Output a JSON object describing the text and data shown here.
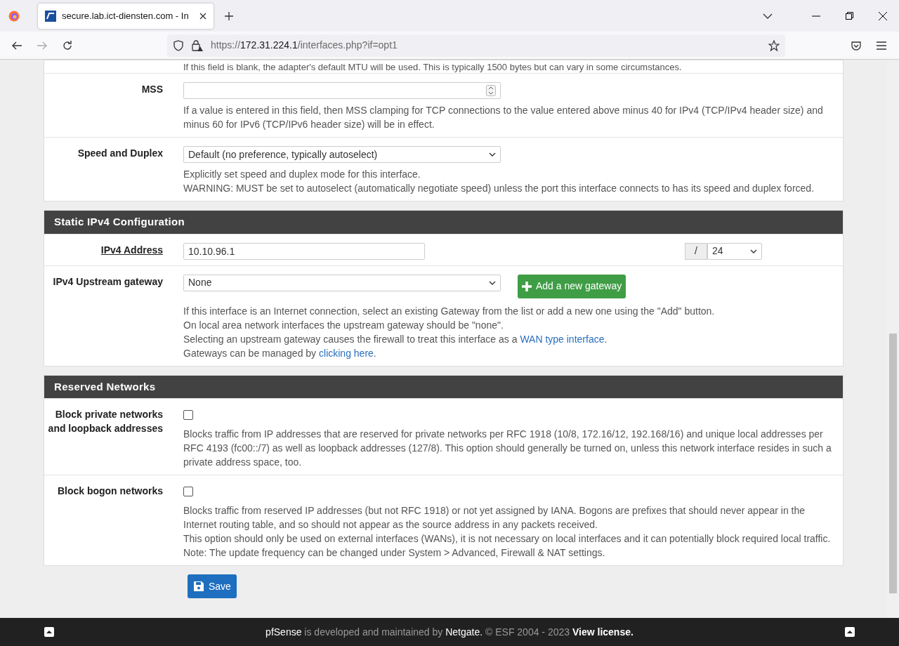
{
  "browser": {
    "tab_title": "secure.lab.ict-diensten.com - In",
    "url_scheme": "https://",
    "url_host": "172.31.224.1",
    "url_path": "/interfaces.php?if=opt1"
  },
  "sections": [
    {
      "partial_text": "If this field is blank, the adapter's default MTU will be used. This is typically 1500 bytes but can vary in some circumstances.",
      "rows": [
        {
          "label": [
            "MSS"
          ],
          "required": false,
          "control": {
            "kind": "number"
          },
          "help": [
            [
              {
                "text": "If a value is entered in this field, then MSS clamping for TCP connections to the value entered above minus 40 for IPv4 (TCP/IPv4 header size) and minus 60 for IPv6 (TCP/IPv6 header size) will be in effect.",
                "kind": "text"
              }
            ]
          ]
        },
        {
          "label": [
            "Speed and Duplex"
          ],
          "required": false,
          "control": {
            "kind": "select",
            "value": "Default (no preference, typically autoselect)"
          },
          "help": [
            [
              {
                "text": "Explicitly set speed and duplex mode for this interface.",
                "kind": "text"
              }
            ],
            [
              {
                "text": "WARNING: MUST be set to autoselect (automatically negotiate speed) unless the port this interface connects to has its speed and duplex forced.",
                "kind": "text"
              }
            ]
          ]
        }
      ]
    },
    {
      "title": "Static IPv4 Configuration",
      "rows": [
        {
          "label": [
            "IPv4 Address"
          ],
          "required": true,
          "control": {
            "kind": "address",
            "value": "10.10.96.1",
            "separator": "/",
            "mask": "24"
          }
        },
        {
          "label": [
            "IPv4 Upstream gateway"
          ],
          "required": false,
          "control": {
            "kind": "select_button",
            "value": "None",
            "button": "Add a new gateway"
          },
          "help": [
            [
              {
                "text": "If this interface is an Internet connection, select an existing Gateway from the list or add a new one using the \"Add\" button.",
                "kind": "text"
              }
            ],
            [
              {
                "text": "On local area network interfaces the upstream gateway should be \"none\".",
                "kind": "text"
              }
            ],
            [
              {
                "text": "Selecting an upstream gateway causes the firewall to treat this interface as a ",
                "kind": "text"
              },
              {
                "text": "WAN type interface",
                "kind": "link"
              },
              {
                "text": ".",
                "kind": "text"
              }
            ],
            [
              {
                "text": "Gateways can be managed by ",
                "kind": "text"
              },
              {
                "text": "clicking here",
                "kind": "link"
              },
              {
                "text": ".",
                "kind": "text"
              }
            ]
          ]
        }
      ]
    },
    {
      "title": "Reserved Networks",
      "rows": [
        {
          "label": [
            "Block private networks",
            "and loopback addresses"
          ],
          "required": false,
          "control": {
            "kind": "checkbox",
            "checked": false
          },
          "help": [
            [
              {
                "text": "Blocks traffic from IP addresses that are reserved for private networks per RFC 1918 (10/8, 172.16/12, 192.168/16) and unique local addresses per RFC 4193 (fc00::/7) as well as loopback addresses (127/8). This option should generally be turned on, unless this network interface resides in such a private address space, too.",
                "kind": "text"
              }
            ]
          ]
        },
        {
          "label": [
            "Block bogon networks"
          ],
          "required": false,
          "control": {
            "kind": "checkbox",
            "checked": false
          },
          "help": [
            [
              {
                "text": "Blocks traffic from reserved IP addresses (but not RFC 1918) or not yet assigned by IANA. Bogons are prefixes that should never appear in the Internet routing table, and so should not appear as the source address in any packets received.",
                "kind": "text"
              }
            ],
            [
              {
                "text": "This option should only be used on external interfaces (WANs), it is not necessary on local interfaces and it can potentially block required local traffic.",
                "kind": "text"
              }
            ],
            [
              {
                "text": "Note: The update frequency can be changed under System > Advanced, Firewall & NAT settings.",
                "kind": "text"
              }
            ]
          ]
        }
      ]
    }
  ],
  "save_button": "Save",
  "footer": [
    {
      "text": "pfSense",
      "kind": "link"
    },
    {
      "text": " is developed and maintained by ",
      "kind": "text"
    },
    {
      "text": "Netgate.",
      "kind": "link"
    },
    {
      "text": " © ESF 2004 - 2023 ",
      "kind": "text"
    },
    {
      "text": "View license.",
      "kind": "strong_link"
    }
  ]
}
